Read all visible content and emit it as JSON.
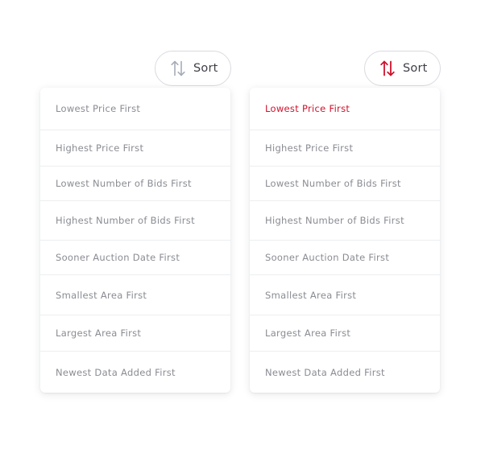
{
  "sort_button_label": "Sort",
  "colors": {
    "accent": "#d0112b",
    "icon_inactive": "#a7abb8",
    "text": "#8a8c93",
    "divider": "#eceef1"
  },
  "panels": [
    {
      "state": "default",
      "button_icon": "sort-arrows-icon",
      "selected_index": null,
      "options": [
        "Lowest Price First",
        "Highest Price First",
        "Lowest Number of Bids First",
        "Highest Number of Bids First",
        "Sooner Auction Date First",
        "Smallest Area First",
        "Largest Area First",
        "Newest Data Added First"
      ]
    },
    {
      "state": "active",
      "button_icon": "sort-arrows-icon",
      "selected_index": 0,
      "options": [
        "Lowest Price First",
        "Highest Price First",
        "Lowest Number of Bids First",
        "Highest Number of Bids First",
        "Sooner Auction Date First",
        "Smallest Area First",
        "Largest Area First",
        "Newest Data Added First"
      ]
    }
  ]
}
